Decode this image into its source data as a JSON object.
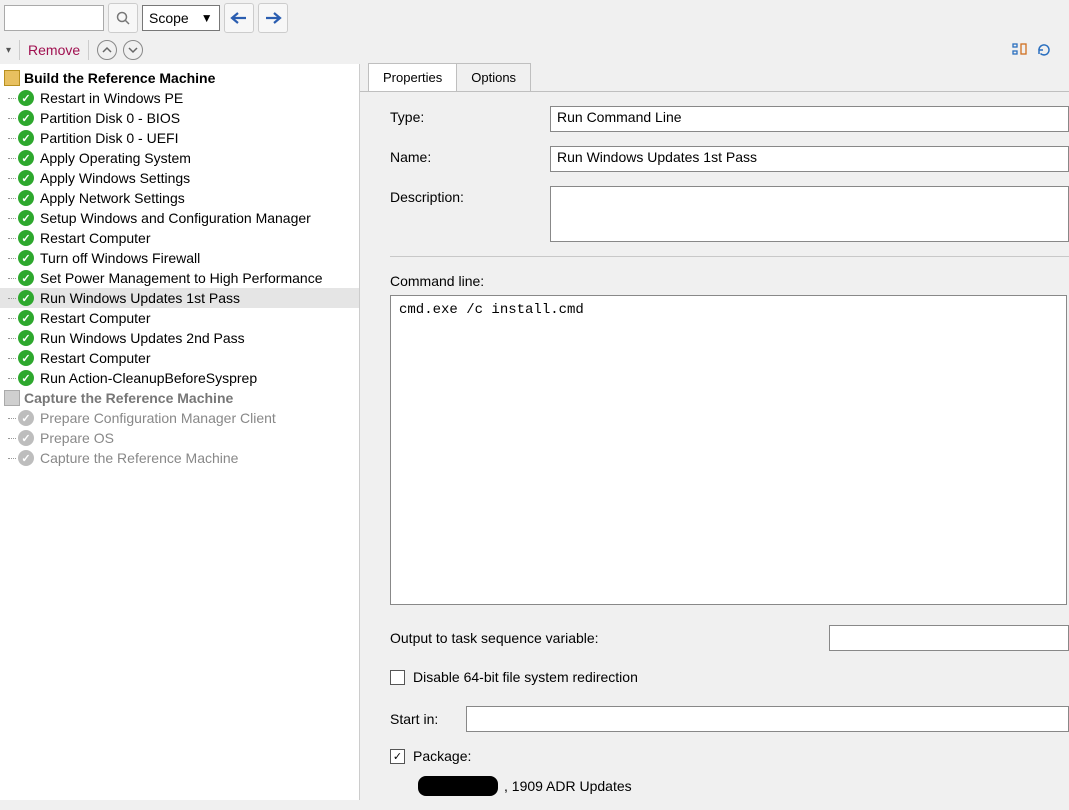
{
  "toolbar": {
    "scope_label": "Scope"
  },
  "actions": {
    "remove": "Remove"
  },
  "tree": {
    "groups": [
      {
        "title": "Build the Reference Machine",
        "disabled": false,
        "items": [
          {
            "label": "Restart in Windows PE",
            "selected": false,
            "disabled": false
          },
          {
            "label": "Partition Disk 0 - BIOS",
            "selected": false,
            "disabled": false
          },
          {
            "label": "Partition Disk 0 - UEFI",
            "selected": false,
            "disabled": false
          },
          {
            "label": "Apply Operating System",
            "selected": false,
            "disabled": false
          },
          {
            "label": "Apply Windows Settings",
            "selected": false,
            "disabled": false
          },
          {
            "label": "Apply Network Settings",
            "selected": false,
            "disabled": false
          },
          {
            "label": "Setup Windows and Configuration Manager",
            "selected": false,
            "disabled": false
          },
          {
            "label": "Restart Computer",
            "selected": false,
            "disabled": false
          },
          {
            "label": "Turn off Windows Firewall",
            "selected": false,
            "disabled": false
          },
          {
            "label": "Set Power Management to High Performance",
            "selected": false,
            "disabled": false
          },
          {
            "label": "Run Windows Updates 1st Pass",
            "selected": true,
            "disabled": false
          },
          {
            "label": "Restart Computer",
            "selected": false,
            "disabled": false
          },
          {
            "label": "Run Windows Updates 2nd Pass",
            "selected": false,
            "disabled": false
          },
          {
            "label": "Restart Computer",
            "selected": false,
            "disabled": false
          },
          {
            "label": "Run Action-CleanupBeforeSysprep",
            "selected": false,
            "disabled": false
          }
        ]
      },
      {
        "title": "Capture the Reference Machine",
        "disabled": true,
        "items": [
          {
            "label": "Prepare Configuration Manager Client",
            "selected": false,
            "disabled": true
          },
          {
            "label": "Prepare OS",
            "selected": false,
            "disabled": true
          },
          {
            "label": "Capture the Reference Machine",
            "selected": false,
            "disabled": true
          }
        ]
      }
    ]
  },
  "tabs": {
    "properties": "Properties",
    "options": "Options"
  },
  "properties": {
    "type_label": "Type:",
    "type_value": "Run Command Line",
    "name_label": "Name:",
    "name_value": "Run Windows Updates 1st Pass",
    "description_label": "Description:",
    "description_value": "",
    "command_label": "Command line:",
    "command_value": "cmd.exe /c install.cmd",
    "output_label": "Output to task sequence variable:",
    "output_value": "",
    "disable_redirect_label": "Disable 64-bit file system redirection",
    "disable_redirect_checked": false,
    "startin_label": "Start in:",
    "startin_value": "",
    "package_label": "Package:",
    "package_checked": true,
    "package_value": ", 1909 ADR Updates"
  }
}
